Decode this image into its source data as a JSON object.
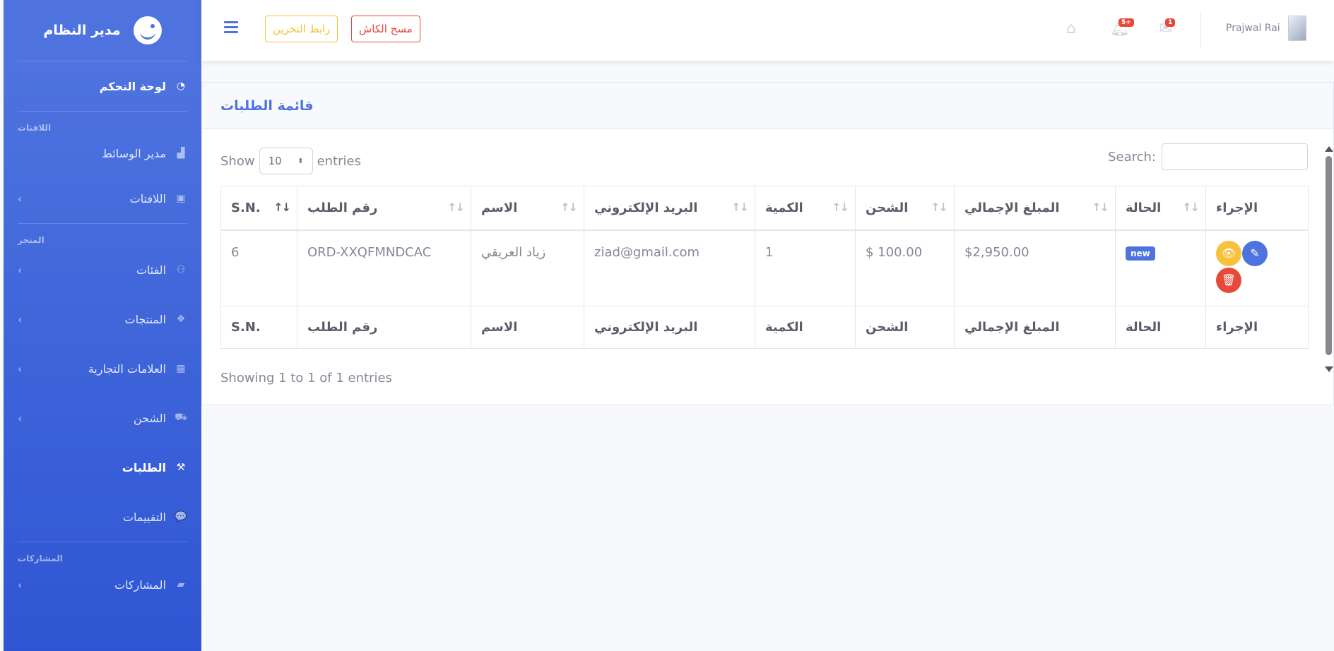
{
  "sidebar": {
    "brand": "مدير النظام",
    "dashboard": "لوحة التحكم",
    "headings": {
      "banners": "اللافتات",
      "store": "المتجر",
      "posts": "المشاركات"
    },
    "items": {
      "media": "مدير الوسائط",
      "banners": "اللافتات",
      "categories": "الفئات",
      "products": "المنتجات",
      "brands": "العلامات التجارية",
      "shipping": "الشحن",
      "orders": "الطلبات",
      "reviews": "التقييمات",
      "posts": "المشاركات"
    }
  },
  "topbar": {
    "storage_link": "رابط التخزين",
    "clear_cache": "مسح الكاش",
    "alerts_count": "5+",
    "messages_count": "1",
    "user_name": "Prajwal Rai"
  },
  "card": {
    "title": "قائمة الطلبات",
    "show_label": "Show",
    "entries_label": "entries",
    "page_size": "10",
    "search_label": "Search:",
    "info": "Showing 1 to 1 of 1 entries"
  },
  "table": {
    "headers": [
      "S.N.",
      "رقم الطلب",
      "الاسم",
      "البريد الإلكتروني",
      "الكمية",
      "الشحن",
      "المبلغ الإجمالي",
      "الحالة",
      "الإجراء"
    ],
    "rows": [
      {
        "sn": "6",
        "order_no": "ORD-XXQFMNDCAC",
        "name": "زياد العريقي",
        "email": "ziad@gmail.com",
        "qty": "1",
        "shipping": "$ 100.00",
        "total": "$2,950.00",
        "status": "new"
      }
    ]
  },
  "colors": {
    "primary": "#4e73df",
    "warning": "#f6c23e",
    "danger": "#e74a3b"
  },
  "icons": [
    "search-icon",
    "bell-icon",
    "envelope-icon",
    "home-icon",
    "eye-icon",
    "edit-icon",
    "trash-icon"
  ]
}
